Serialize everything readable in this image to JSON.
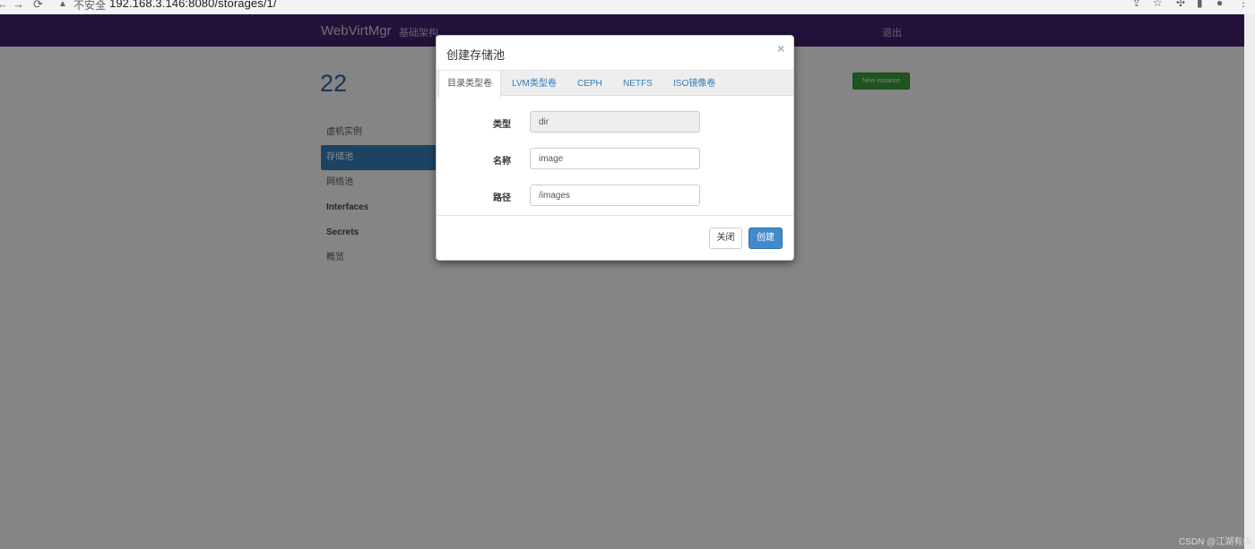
{
  "browser": {
    "back_icon": "←",
    "forward_icon": "→",
    "reload_icon": "⟳",
    "warning_icon": "▲",
    "insecure_label": "不安全",
    "separator": "|",
    "url": "192.168.3.146:8080/storages/1/",
    "toolbar_icons": [
      "share-icon",
      "star-icon",
      "extensions-icon",
      "side-panel-icon",
      "profile-icon",
      "menu-icon"
    ]
  },
  "navbar": {
    "brand": "WebVirtMgr",
    "infrastructure_link": "基础架构",
    "logout_link": "退出"
  },
  "page": {
    "title": "22",
    "new_instance_label": "New instance"
  },
  "sidebar": {
    "items": [
      {
        "label": "虚机实例"
      },
      {
        "label": "存储池"
      },
      {
        "label": "网络池"
      },
      {
        "label": "Interfaces"
      },
      {
        "label": "Secrets"
      },
      {
        "label": "概览"
      }
    ]
  },
  "modal": {
    "title": "创建存储池",
    "close_glyph": "×",
    "tabs": [
      {
        "label": "目录类型卷",
        "active": true
      },
      {
        "label": "LVM类型卷"
      },
      {
        "label": "CEPH"
      },
      {
        "label": "NETFS"
      },
      {
        "label": "ISO镜像卷"
      }
    ],
    "fields": {
      "type_label": "类型",
      "type_value": "dir",
      "name_label": "名称",
      "name_value": "image",
      "path_label": "路径",
      "path_value": "/images"
    },
    "close_button": "关闭",
    "create_button": "创建"
  },
  "watermark": "CSDN @江湖有缘",
  "colors": {
    "navbar": "#3e2268",
    "primary": "#428bca",
    "success": "#3a9a3a",
    "link": "#337ab7"
  }
}
